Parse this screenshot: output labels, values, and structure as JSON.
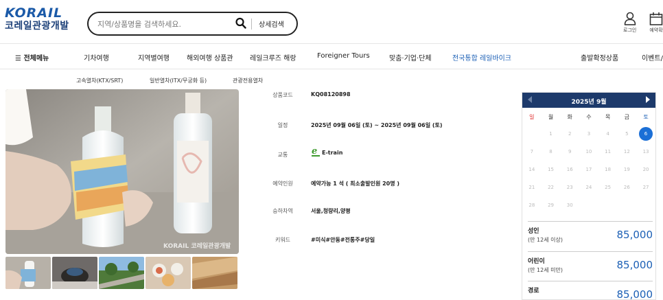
{
  "header": {
    "logo_top": "KORAIL",
    "logo_bottom": "코레일관광개발",
    "search_placeholder": "지역/상품명을 검색하세요.",
    "search_detail": "상세검색",
    "login": "로그인",
    "reservation": "예약확"
  },
  "gnb": {
    "all_menu": "☰ 전체메뉴",
    "items": [
      "기차여행",
      "지역별여행",
      "해외여행 상품관",
      "레일크루즈 해랑",
      "Foreigner Tours",
      "맞춤·기업·단체",
      "전국통합 레일바이크",
      "출발확정상품",
      "이벤트/"
    ]
  },
  "subnav": [
    "고속열차(KTX/SRT)",
    "일반열차(ITX/무궁화 등)",
    "관광전용열차"
  ],
  "photo": {
    "watermark": "KORAIL 코레일관광개발"
  },
  "info": {
    "product_code": {
      "label": "상품코드",
      "value": "KQ08120898"
    },
    "schedule": {
      "label": "일정",
      "value": "2025년 09월 06일 (토) ~ 2025년 09월 06일 (토)"
    },
    "transport": {
      "label": "교통",
      "value": "E-train"
    },
    "capacity": {
      "label": "예약인원",
      "value": "예약가능 1 석 ( 최소출발인원 20명 )"
    },
    "stations": {
      "label": "승하차역",
      "value": "서울,청량리,양평"
    },
    "keywords": {
      "label": "키워드",
      "value": "#미식#안동#전통주#당일"
    }
  },
  "calendar": {
    "title": "2025년 9월",
    "weekdays": [
      "일",
      "월",
      "화",
      "수",
      "목",
      "금",
      "토"
    ],
    "weeks": [
      [
        "",
        "1",
        "2",
        "3",
        "4",
        "5",
        "6"
      ],
      [
        "7",
        "8",
        "9",
        "10",
        "11",
        "12",
        "13"
      ],
      [
        "14",
        "15",
        "16",
        "17",
        "18",
        "19",
        "20"
      ],
      [
        "21",
        "22",
        "23",
        "24",
        "25",
        "26",
        "27"
      ],
      [
        "28",
        "29",
        "30",
        "",
        "",
        "",
        ""
      ]
    ],
    "selected_day": "6"
  },
  "prices": [
    {
      "label": "성인",
      "sub": "(만 12세 이상)",
      "value": "85,000"
    },
    {
      "label": "어린이",
      "sub": "(만 12세 미만)",
      "value": "85,000"
    },
    {
      "label": "경로",
      "sub": "",
      "value": "85,000"
    }
  ],
  "colors": {
    "brand_blue": "#1b5aa8",
    "calendar_header": "#1d3a6b",
    "price_blue": "#1b5fb5",
    "selected_day": "#1b6fd6",
    "sunday_red": "#e02d2d"
  }
}
